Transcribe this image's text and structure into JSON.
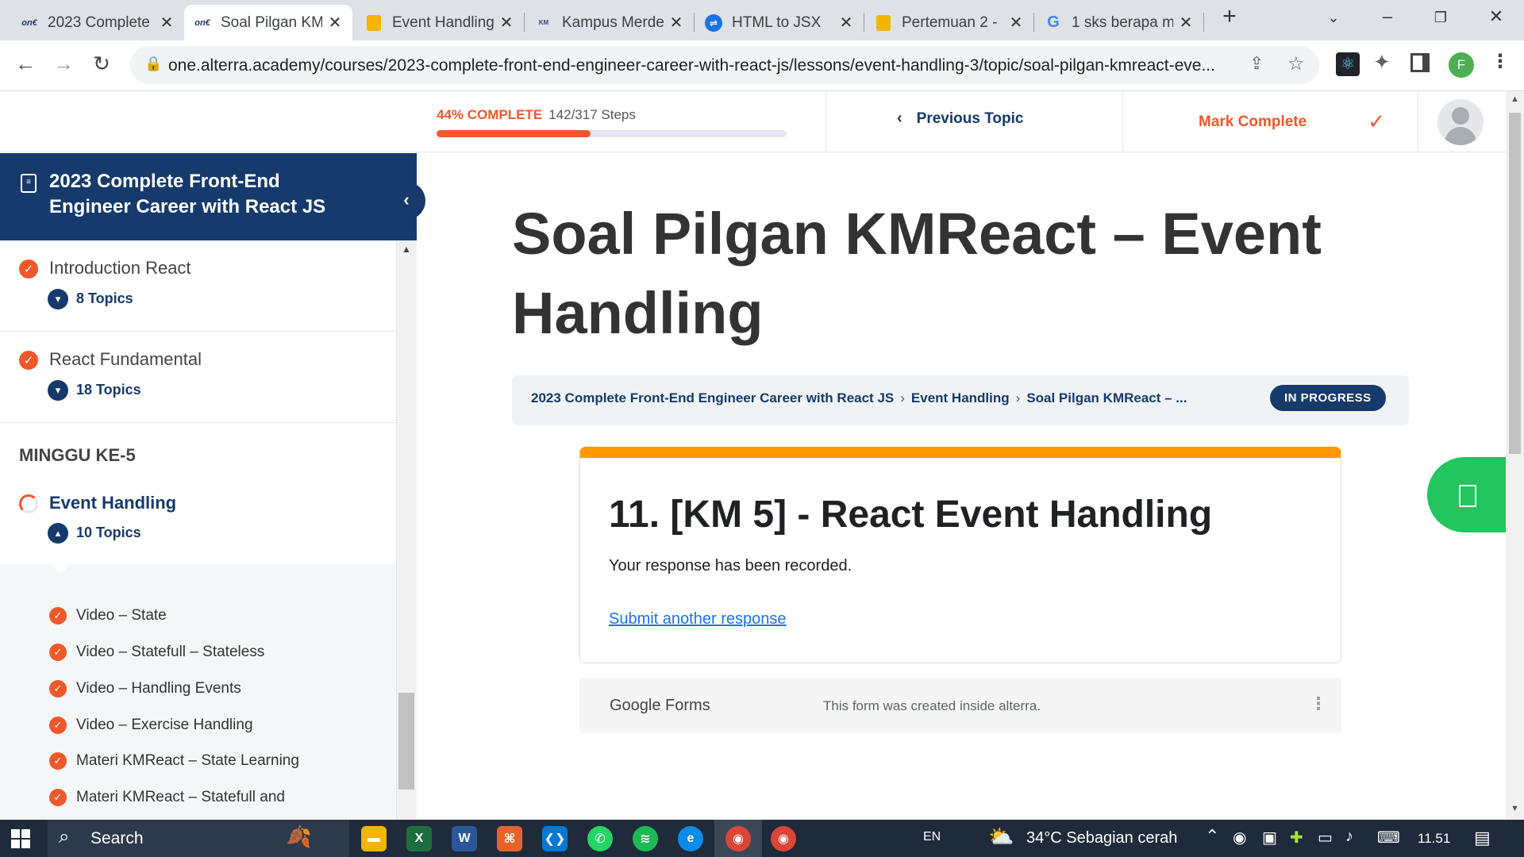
{
  "browser": {
    "tabs": [
      {
        "title": "2023 Complete",
        "icon": "alterra-icon"
      },
      {
        "title": "Soal Pilgan KM",
        "icon": "alterra-icon",
        "active": true
      },
      {
        "title": "Event Handling",
        "icon": "slides-icon"
      },
      {
        "title": "Kampus Merde",
        "icon": "kampus-merdeka-icon"
      },
      {
        "title": "HTML to JSX",
        "icon": "transform-icon"
      },
      {
        "title": "Pertemuan 2 -",
        "icon": "slides-icon"
      },
      {
        "title": "1 sks berapa m",
        "icon": "google-icon"
      }
    ],
    "url": "one.alterra.academy/courses/2023-complete-front-end-engineer-career-with-react-js/lessons/event-handling-3/topic/soal-pilgan-kmreact-eve...",
    "profile_initial": "F"
  },
  "progress": {
    "percent_label": "44% COMPLETE",
    "steps_label": "142/317 Steps",
    "fraction": 0.44,
    "previous_topic": "Previous Topic",
    "mark_complete": "Mark Complete"
  },
  "sidebar": {
    "course_title": "2023 Complete Front-End Engineer Career with React JS",
    "lessons": [
      {
        "title": "Introduction React",
        "topics": "8 Topics"
      },
      {
        "title": "React Fundamental",
        "topics": "18 Topics"
      }
    ],
    "section": "MINGGU KE-5",
    "current_lesson": {
      "title": "Event Handling",
      "topics": "10 Topics"
    },
    "topic_items": [
      "Video – State",
      "Video – Statefull – Stateless",
      "Video – Handling Events",
      "Video – Exercise Handling",
      "Materi KMReact – State Learning",
      "Materi KMReact – Statefull and"
    ]
  },
  "main": {
    "title": "Soal Pilgan KMReact – Event Handling",
    "breadcrumb": [
      "2023 Complete Front-End Engineer Career with React JS",
      "Event Handling",
      "Soal Pilgan KMReact – ..."
    ],
    "status_badge": "IN PROGRESS",
    "form": {
      "title": "11. [KM 5] - React Event Handling",
      "message": "Your response has been recorded.",
      "link": "Submit another response",
      "footer_brand": "Google Forms",
      "footer_note": "This form was created inside alterra."
    }
  },
  "taskbar": {
    "search": "Search",
    "lang": "EN",
    "weather": "34°C  Sebagian cerah",
    "time": "11.51"
  },
  "colors": {
    "brand_navy": "#163a6b",
    "accent_orange": "#f0582a",
    "form_accent": "#ff9800",
    "fab_green": "#22c55e"
  }
}
